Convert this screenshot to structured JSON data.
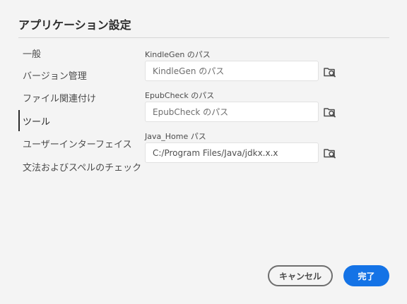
{
  "dialog": {
    "title": "アプリケーション設定"
  },
  "sidebar": {
    "items": [
      {
        "label": "一般"
      },
      {
        "label": "バージョン管理"
      },
      {
        "label": "ファイル関連付け"
      },
      {
        "label": "ツール",
        "active": true
      },
      {
        "label": "ユーザーインターフェイス"
      },
      {
        "label": "文法およびスペルのチェック"
      }
    ]
  },
  "fields": {
    "kindlegen": {
      "label": "KindleGen のパス",
      "placeholder": "KindleGen のパス",
      "value": ""
    },
    "epubcheck": {
      "label": "EpubCheck のパス",
      "placeholder": "EpubCheck のパス",
      "value": ""
    },
    "javahome": {
      "label": "Java_Home パス",
      "placeholder": "",
      "value": "C:/Program Files/Java/jdkx.x.x"
    }
  },
  "icons": {
    "browse": "folder-search-icon"
  },
  "buttons": {
    "cancel": "キャンセル",
    "done": "完了"
  },
  "colors": {
    "accent": "#1473e6",
    "background": "#f4f4f4"
  }
}
